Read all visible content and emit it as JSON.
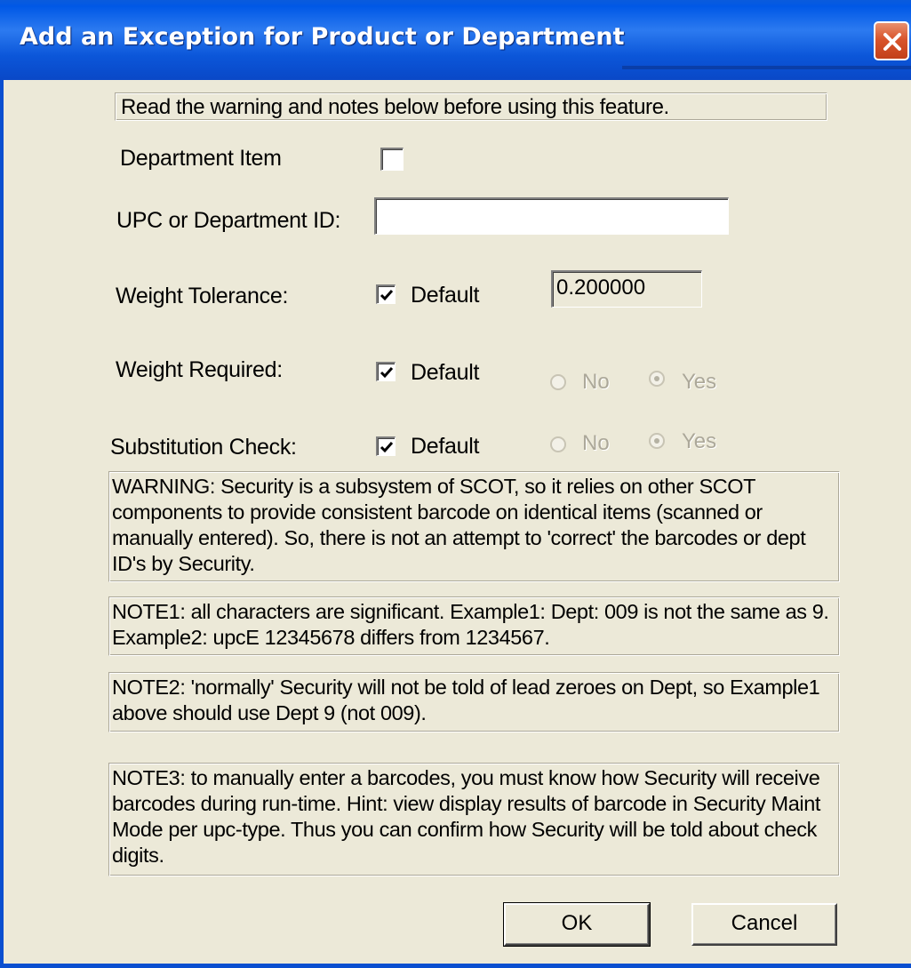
{
  "window": {
    "title": "Add an Exception for Product or Department"
  },
  "header_note": "Read the warning and notes below before using this feature.",
  "department_item": {
    "label": "Department Item",
    "checked": false
  },
  "upc": {
    "label": "UPC or Department ID:",
    "value": ""
  },
  "weight_tolerance": {
    "label": "Weight Tolerance:",
    "default_label": "Default",
    "default_checked": true,
    "value": "0.200000"
  },
  "weight_required": {
    "label": "Weight Required:",
    "default_label": "Default",
    "default_checked": true,
    "no_label": "No",
    "yes_label": "Yes",
    "selected": "Yes"
  },
  "substitution_check": {
    "label": "Substitution Check:",
    "default_label": "Default",
    "default_checked": true,
    "no_label": "No",
    "yes_label": "Yes",
    "selected": "Yes"
  },
  "notes": {
    "warning": "WARNING: Security is a subsystem of SCOT, so it relies on other SCOT components to provide consistent barcode on identical items (scanned or manually entered).  So, there is not an attempt to 'correct' the barcodes or dept ID's by Security.",
    "note1": "NOTE1: all characters are significant.  Example1: Dept: 009 is not the same as 9.  Example2: upcE 12345678 differs from 1234567.",
    "note2": "NOTE2: 'normally' Security will not be told of lead zeroes on Dept, so Example1 above should use Dept 9 (not 009).",
    "note3": "NOTE3:  to manually enter a barcodes, you must know how Security will receive barcodes during run-time.  Hint: view display results of barcode in Security Maint Mode per upc-type.  Thus you can confirm how Security will be told about check digits."
  },
  "buttons": {
    "ok": "OK",
    "cancel": "Cancel"
  },
  "colors": {
    "title_bar": "#0a5bdc",
    "dialog_bg": "#ece9d8",
    "close_button": "#d9552c"
  }
}
